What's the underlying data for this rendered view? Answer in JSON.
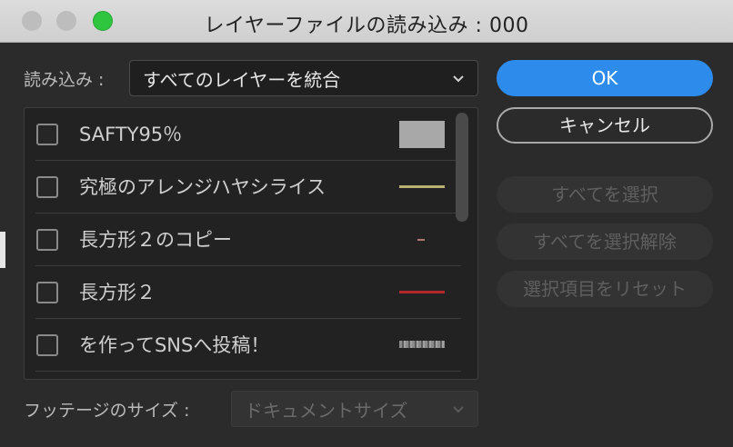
{
  "window": {
    "title": "レイヤーファイルの読み込み : 000"
  },
  "import": {
    "label": "読み込み :",
    "value": "すべてのレイヤーを統合"
  },
  "layers": [
    {
      "name": "SAFTY95％",
      "thumb": "gray-box"
    },
    {
      "name": "究極のアレンジハヤシライス",
      "thumb": "olive-line"
    },
    {
      "name": "長方形２のコピー",
      "thumb": "tiny-dash"
    },
    {
      "name": "長方形２",
      "thumb": "red-line"
    },
    {
      "name": "を作ってSNSへ投稿！",
      "thumb": "noise-strip"
    }
  ],
  "buttons": {
    "ok": "OK",
    "cancel": "キャンセル",
    "select_all": "すべてを選択",
    "deselect_all": "すべてを選択解除",
    "reset": "選択項目をリセット"
  },
  "footage": {
    "label": "フッテージのサイズ :",
    "value": "ドキュメントサイズ"
  },
  "colors": {
    "accent": "#2d8ceb",
    "maximize": "#2fc53f"
  }
}
